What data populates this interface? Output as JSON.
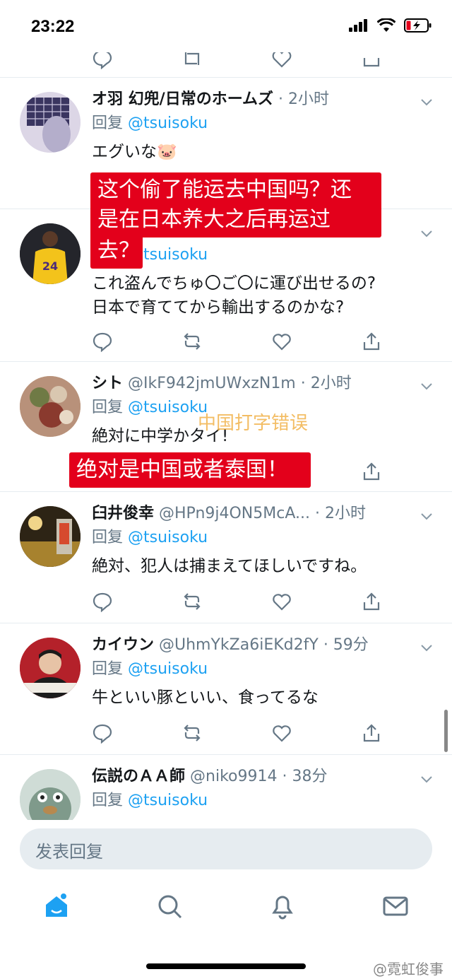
{
  "status_bar": {
    "time": "23:22"
  },
  "tweets": [
    {
      "name": "オ羽 幻兜/日常のホームズ",
      "handle": "",
      "time": "· 2小时",
      "reply_prefix": "回复",
      "reply_to": "@tsuisoku",
      "body": "エグいな🐷"
    },
    {
      "name": "",
      "handle": "",
      "time": "",
      "reply_prefix": "回复",
      "reply_to": "@tsuisoku",
      "body_line1": "これ盗んでちゅ〇ご〇に運び出せるの?",
      "body_line2": "日本で育ててから輸出するのかな?"
    },
    {
      "name": "シト",
      "handle": "@IkF942jmUWxzN1m",
      "time": "· 2小时",
      "reply_prefix": "回复",
      "reply_to": "@tsuisoku",
      "body": "絶対に中学かタイ!"
    },
    {
      "name": "臼井俊幸",
      "handle": "@HPn9j4ON5McA...",
      "time": "· 2小时",
      "reply_prefix": "回复",
      "reply_to": "@tsuisoku",
      "body": "絶対、犯人は捕まえてほしいですね。"
    },
    {
      "name": "カイウン",
      "handle": "@UhmYkZa6iEKd2fY",
      "time": "· 59分",
      "reply_prefix": "回复",
      "reply_to": "@tsuisoku",
      "body": "牛といい豚といい、食ってるな"
    },
    {
      "name": "伝説のＡＡ師",
      "handle": "@niko9914",
      "time": "· 38分",
      "reply_prefix": "回复",
      "reply_to": "@tsuisoku",
      "body": ""
    }
  ],
  "overlays": {
    "red_1_line1": "这个偷了能运去中国吗？还",
    "red_1_line2": "是在日本养大之后再运过",
    "red_1_line3": "去？",
    "orange_note": "中国打字错误",
    "red_2": "绝对是中国或者泰国！"
  },
  "composer": {
    "placeholder": "发表回复"
  },
  "watermark": "@霓虹俊事",
  "colors": {
    "link": "#1da1f2",
    "secondary_text": "#657786",
    "divider": "#e6ecf0",
    "overlay_red": "#e3001b",
    "overlay_orange": "#f1b24a"
  }
}
